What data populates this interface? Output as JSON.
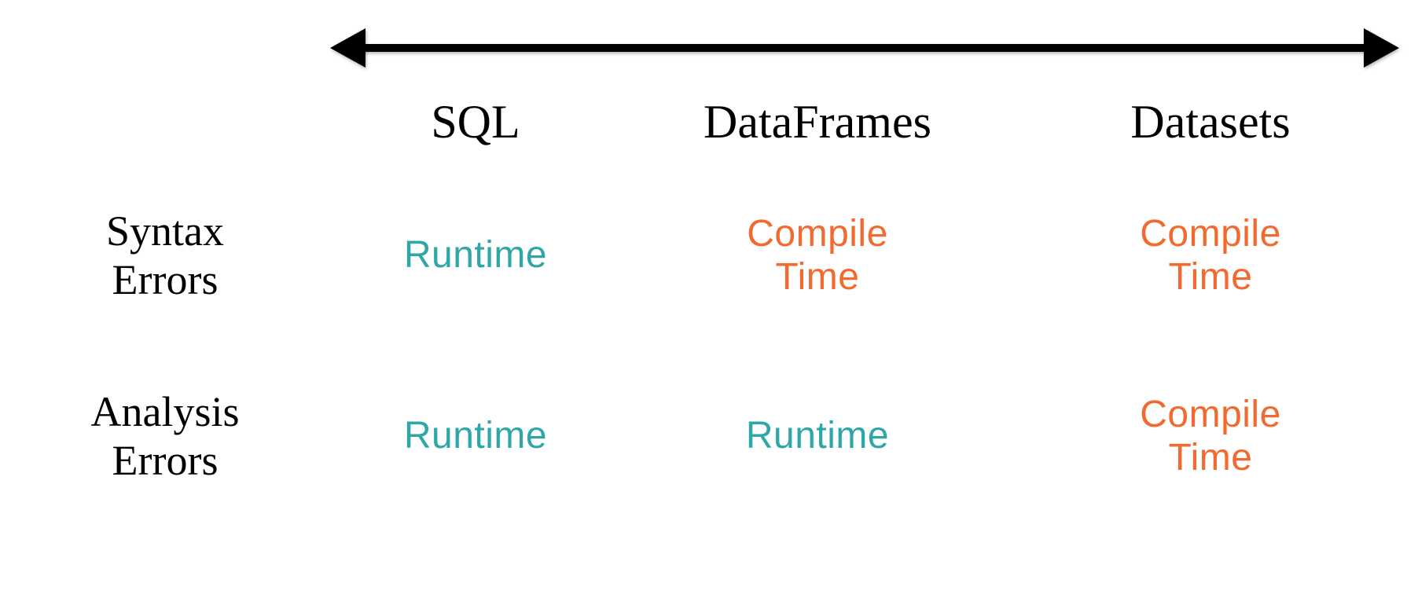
{
  "columns": {
    "c1": "SQL",
    "c2": "DataFrames",
    "c3": "Datasets"
  },
  "rows": {
    "r1": "Syntax\nErrors",
    "r2": "Analysis\nErrors"
  },
  "cells": {
    "r1c1": {
      "text": "Runtime",
      "kind": "teal"
    },
    "r1c2": {
      "text": "Compile\nTime",
      "kind": "orange"
    },
    "r1c3": {
      "text": "Compile\nTime",
      "kind": "orange"
    },
    "r2c1": {
      "text": "Runtime",
      "kind": "teal"
    },
    "r2c2": {
      "text": "Runtime",
      "kind": "teal"
    },
    "r2c3": {
      "text": "Compile\nTime",
      "kind": "orange"
    }
  }
}
